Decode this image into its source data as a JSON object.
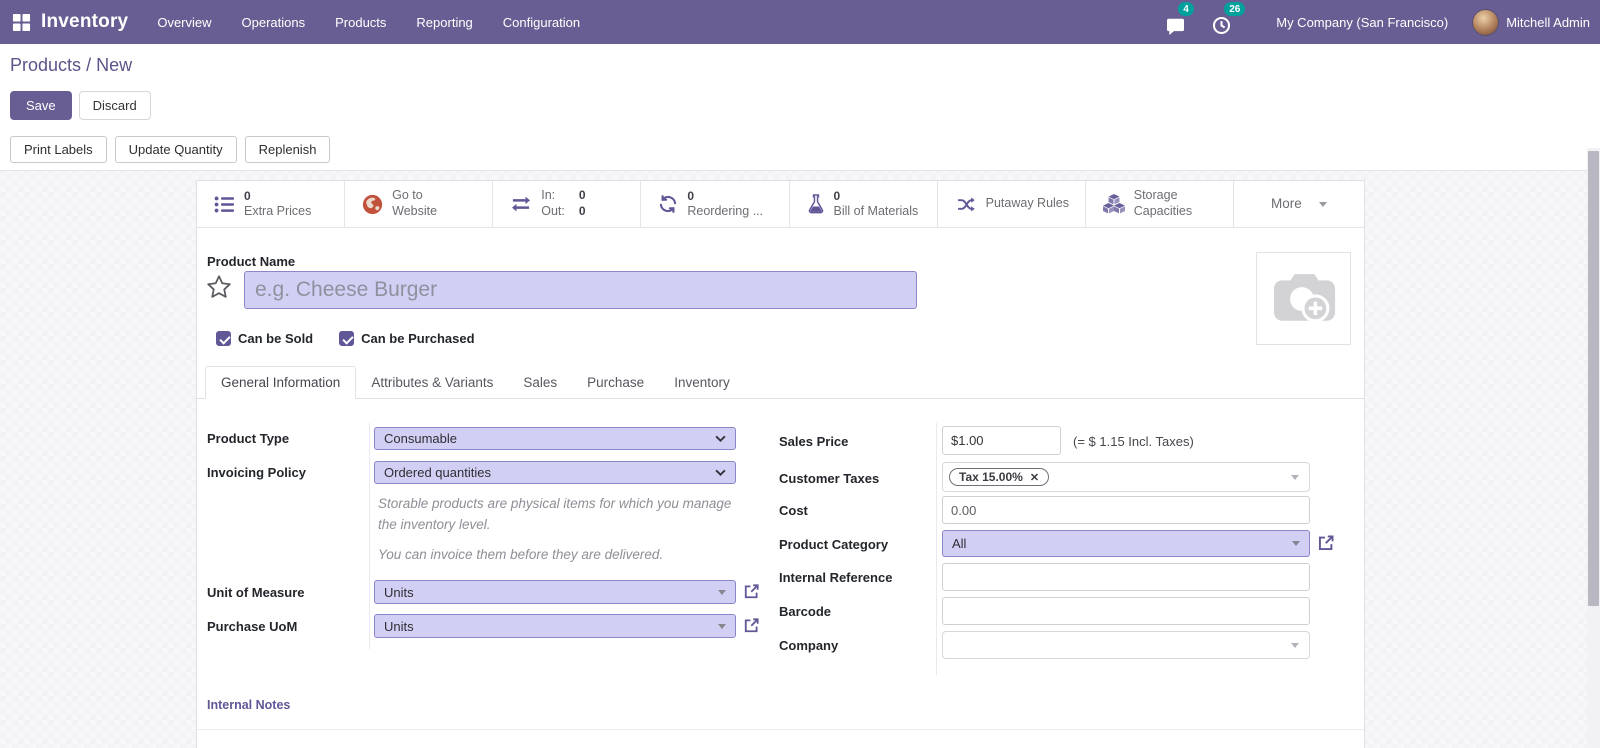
{
  "colors": {
    "navbar_bg": "#685e93",
    "badge_bg": "#00a09d",
    "accent_purple": "#5f5796",
    "field_highlight_bg": "#d1d0f4",
    "link_purple": "#5b5489",
    "globe_orange": "#c1513a"
  },
  "navbar": {
    "app_name": "Inventory",
    "menus": [
      "Overview",
      "Operations",
      "Products",
      "Reporting",
      "Configuration"
    ],
    "messages_badge": "4",
    "activities_badge": "26",
    "company": "My Company (San Francisco)",
    "user": "Mitchell Admin"
  },
  "breadcrumb": {
    "parent": "Products",
    "separator": "/",
    "current": "New"
  },
  "actions": {
    "save": "Save",
    "discard": "Discard"
  },
  "secondary_actions": [
    "Print Labels",
    "Update Quantity",
    "Replenish"
  ],
  "stats": {
    "extra_prices": {
      "value": "0",
      "label": "Extra Prices"
    },
    "website": {
      "line1": "Go to",
      "line2": "Website"
    },
    "inout": {
      "in_label": "In:",
      "in_value": "0",
      "out_label": "Out:",
      "out_value": "0"
    },
    "reordering": {
      "value": "0",
      "label": "Reordering ..."
    },
    "bom": {
      "value": "0",
      "label": "Bill of Materials"
    },
    "putaway": {
      "label": "Putaway Rules"
    },
    "storage": {
      "line1": "Storage",
      "line2": "Capacities"
    },
    "more": {
      "label": "More"
    }
  },
  "product": {
    "name_label": "Product Name",
    "name_placeholder": "e.g. Cheese Burger",
    "can_be_sold": "Can be Sold",
    "can_be_purchased": "Can be Purchased"
  },
  "tabs": [
    "General Information",
    "Attributes & Variants",
    "Sales",
    "Purchase",
    "Inventory"
  ],
  "fields": {
    "product_type": {
      "label": "Product Type",
      "value": "Consumable"
    },
    "invoicing_policy": {
      "label": "Invoicing Policy",
      "value": "Ordered quantities"
    },
    "help_text_1": "Storable products are physical items for which you manage the inventory level.",
    "help_text_2": "You can invoice them before they are delivered.",
    "uom": {
      "label": "Unit of Measure",
      "value": "Units"
    },
    "purchase_uom": {
      "label": "Purchase UoM",
      "value": "Units"
    },
    "sales_price": {
      "label": "Sales Price",
      "value": "$1.00",
      "note": "(= $ 1.15 Incl. Taxes)"
    },
    "customer_taxes": {
      "label": "Customer Taxes",
      "tag": "Tax 15.00%",
      "tag_remove": "✕"
    },
    "cost": {
      "label": "Cost",
      "value": "0.00"
    },
    "product_category": {
      "label": "Product Category",
      "value": "All"
    },
    "internal_reference": {
      "label": "Internal Reference",
      "value": ""
    },
    "barcode": {
      "label": "Barcode",
      "value": ""
    },
    "company": {
      "label": "Company",
      "value": ""
    }
  },
  "notes": {
    "internal_notes_label": "Internal Notes"
  }
}
